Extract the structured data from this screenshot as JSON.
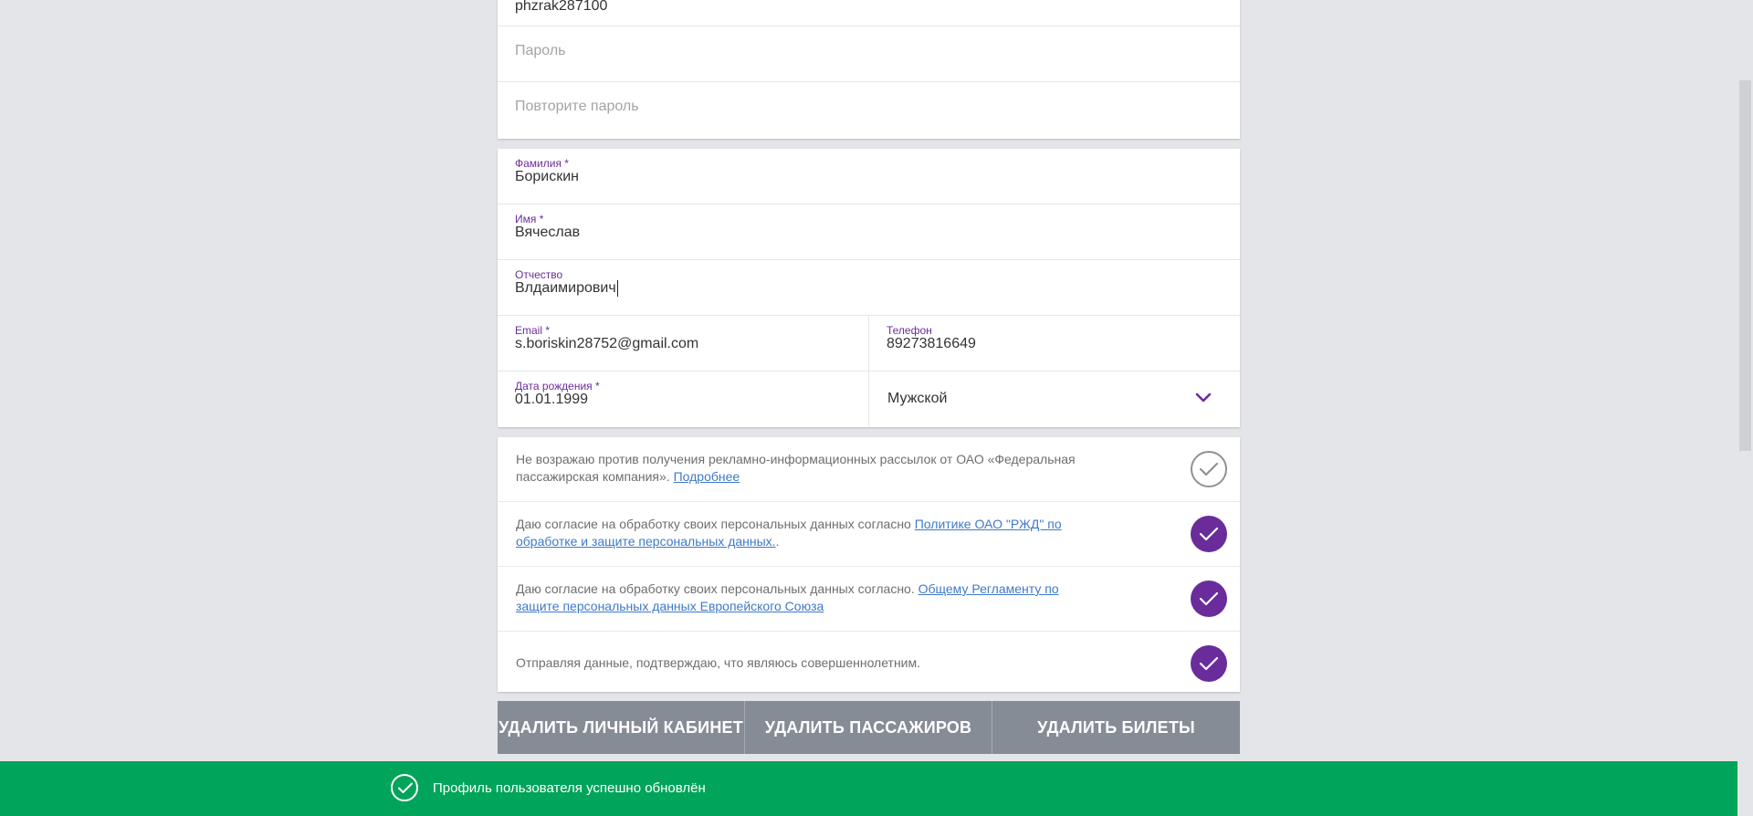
{
  "account": {
    "login_value": "phzrak287100",
    "password_placeholder": "Пароль",
    "repeat_password_placeholder": "Повторите пароль"
  },
  "personal": {
    "surname_label": "Фамилия *",
    "surname_value": "Борискин",
    "name_label": "Имя *",
    "name_value": "Вячеслав",
    "patronymic_label": "Отчество",
    "patronymic_value": "Влдаимирович",
    "email_label": "Email *",
    "email_value": "s.boriskin28752@gmail.com",
    "phone_label": "Телефон",
    "phone_value": "89273816649",
    "birthdate_label": "Дата рождения *",
    "birthdate_value": "01.01.1999",
    "gender_value": "Мужской"
  },
  "consents": [
    {
      "text": "Не возражаю против получения рекламно-информационных рассылок от ОАО «Федеральная пассажирская компания». ",
      "link": "Подробнее",
      "after": "",
      "checked": false
    },
    {
      "text": "Даю согласие на обработку своих персональных данных согласно ",
      "link": "Политике ОАО \"РЖД\" по обработке и защите персональных данных.",
      "after": ".",
      "checked": true
    },
    {
      "text": "Даю согласие на обработку своих персональных данных согласно. ",
      "link": "Общему Регламенту по защите персональных данных Европейского Союза",
      "after": "",
      "checked": true
    },
    {
      "text": "Отправляя данные, подтверждаю, что являюсь совершеннолетним.",
      "link": "",
      "after": "",
      "checked": true
    }
  ],
  "buttons": {
    "delete_account": "УДАЛИТЬ ЛИЧНЫЙ КАБИНЕТ",
    "delete_passengers": "УДАЛИТЬ ПАССАЖИРОВ",
    "delete_tickets": "УДАЛИТЬ БИЛЕТЫ"
  },
  "toast": {
    "message": "Профиль пользователя успешно обновлён"
  },
  "colors": {
    "accent_purple": "#6a2c9a",
    "button_gray": "#868c96",
    "toast_green": "#00a45a",
    "link_blue": "#3f79c8"
  },
  "icons": {
    "check": "checkmark-icon",
    "chevron": "chevron-down-icon",
    "toast": "check-circle-icon"
  }
}
